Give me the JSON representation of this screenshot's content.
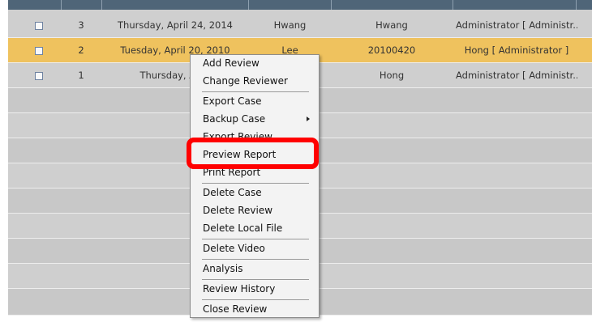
{
  "rows": [
    {
      "number": "3",
      "date": "Thursday, April 24, 2014",
      "col3": "Hwang",
      "col4": "Hwang",
      "col5": "Administrator [ Administr..."
    },
    {
      "number": "2",
      "date": "Tuesday, April 20, 2010",
      "col3": "Lee",
      "col4": "20100420",
      "col5": "Hong [ Administrator ]"
    },
    {
      "number": "1",
      "date": "Thursday, April",
      "col3": "",
      "col4": "Hong",
      "col5": "Administrator [ Administr..."
    }
  ],
  "menu": {
    "add_review": "Add Review",
    "change_reviewer": "Change Reviewer",
    "export_case": "Export Case",
    "backup_case": "Backup Case",
    "export_review": "Export Review",
    "preview_report": "Preview Report",
    "print_report": "Print Report",
    "delete_case": "Delete Case",
    "delete_review": "Delete Review",
    "delete_local_file": "Delete Local File",
    "delete_video": "Delete Video",
    "analysis": "Analysis",
    "review_history": "Review History",
    "close_review": "Close Review"
  },
  "colors": {
    "header": "#4f6578",
    "selected_row": "#efc25e",
    "highlight": "#ff0000"
  }
}
